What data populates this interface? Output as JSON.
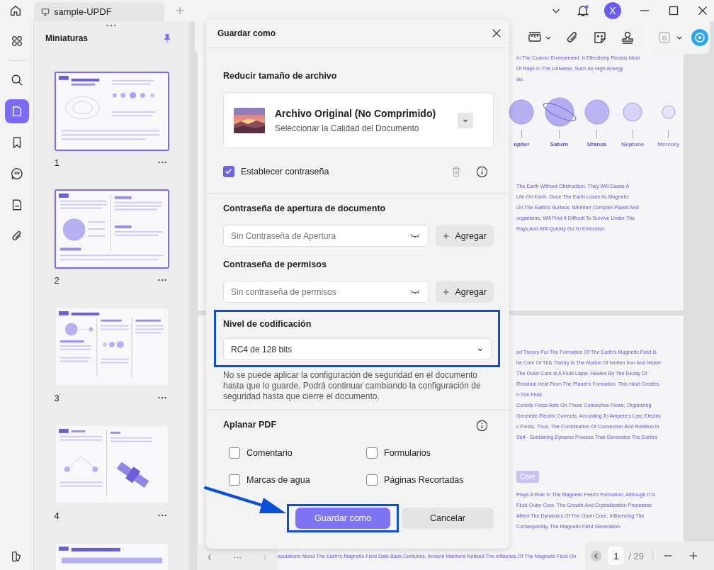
{
  "tab": {
    "title": "sample-UPDF"
  },
  "account": {
    "avatar": "X",
    "notification": true
  },
  "sidebar": {
    "items": [
      {
        "kind": "grid",
        "selected": false
      },
      {
        "kind": "search",
        "selected": false
      },
      {
        "kind": "pages",
        "selected": true
      },
      {
        "kind": "bookmark",
        "selected": false
      },
      {
        "kind": "comment",
        "selected": false
      },
      {
        "kind": "form",
        "selected": false
      },
      {
        "kind": "attachment",
        "selected": false
      }
    ]
  },
  "thumbnails": {
    "title": "Miniaturas",
    "pages": [
      {
        "label": "1",
        "selected": true
      },
      {
        "label": "2",
        "selected": true
      },
      {
        "label": "3",
        "selected": false
      },
      {
        "label": "4",
        "selected": false
      },
      {
        "selected": false
      }
    ]
  },
  "document": {
    "page_1": {
      "lines_top": [
        "In The Cosmic Environment. It Effectively Resists Most",
        "Of Rays In The Universe, Such As High-Energy",
        "ws."
      ],
      "planets": [
        "upiter",
        "Saturn",
        "Uranus",
        "Neptune",
        "Mercury"
      ],
      "lines_bottom": [
        "The Earth Without Obstruction. They Will Cause A",
        "Life On Earth. Once The Earth Loses Its Magnetic",
        "On The Earth's Surface, Whether Complex Plants And",
        "organisms, Will Find It Difficult To Survive Under The",
        "Rays And Will Quickly Go To Extinction."
      ]
    },
    "page_2": {
      "lines": [
        "ed Theory For The Formation Of The Earth's Magnetic Field Is",
        "he Core Of This Theory Is The Motion Of Molten Iron And Nickel",
        "The Outer Core Is A Fluid Layer, Heated By The Decay Of",
        "Residual Heat From The Planet's Formation. This Heat Creates",
        "n The Fluid.",
        "Coriolis Force Acts On These Convective Flows, Organizing",
        "Generate Electric Currents. According To Ampere's Law, Electric",
        "c Fields. Thus, The Combination Of Convection And Rotation in",
        "Self - Sustaining Dynamo Process That Generates The Earth's"
      ],
      "heading": "Core",
      "lines_after": [
        "Plays A Role In The Magnetic Field's Formation. Although It Is",
        "Fluid Outer Core. The Growth And Crystallization Processes",
        "Affect The Dynamics Of The Outer Core, Influencing The",
        "Consequently, The Magnetic Field Generation."
      ],
      "footer_line": "eculations About The Earth's Magnetic Field Date Back Centuries. Ancient Mariners Noticed The Influence Of The Magnetic Field On"
    }
  },
  "page_nav": {
    "more": "···",
    "current": "1",
    "total": "/ 29"
  },
  "dialog": {
    "title": "Guardar como",
    "compress": {
      "heading": "Reducir tamaño de archivo",
      "option": "Archivo Original (No Comprimido)",
      "hint": "Seleccionar la Calidad del Documento"
    },
    "set_password": {
      "label": "Establecer contraseña",
      "checked": true
    },
    "open_password": {
      "heading": "Contraseña de apertura de documento",
      "value": "Sin Contraseña de Apertura",
      "button": "Agregar"
    },
    "permissions_password": {
      "heading": "Contraseña de permisos",
      "value": "Sin contraseña de permisos",
      "button": "Agregar"
    },
    "encryption": {
      "heading": "Nivel de codificación",
      "value": "RC4 de 128 bits",
      "highlighted": true
    },
    "note": "No se puede aplicar la configuración de seguridad en el documento hasta que lo guarde. Podrá continuar cambiando la configuración de seguridad hasta que cierre el documento.",
    "flatten": {
      "heading": "Aplanar PDF",
      "options": [
        {
          "label": "Comentario",
          "checked": false
        },
        {
          "label": "Formularios",
          "checked": false
        },
        {
          "label": "Marcas de agua",
          "checked": false
        },
        {
          "label": "Páginas Recortadas",
          "checked": false
        }
      ]
    },
    "buttons": [
      {
        "label": "Guardar como",
        "kind": "primary",
        "highlighted": true
      },
      {
        "label": "Cancelar",
        "kind": "secondary",
        "highlighted": false
      }
    ]
  }
}
